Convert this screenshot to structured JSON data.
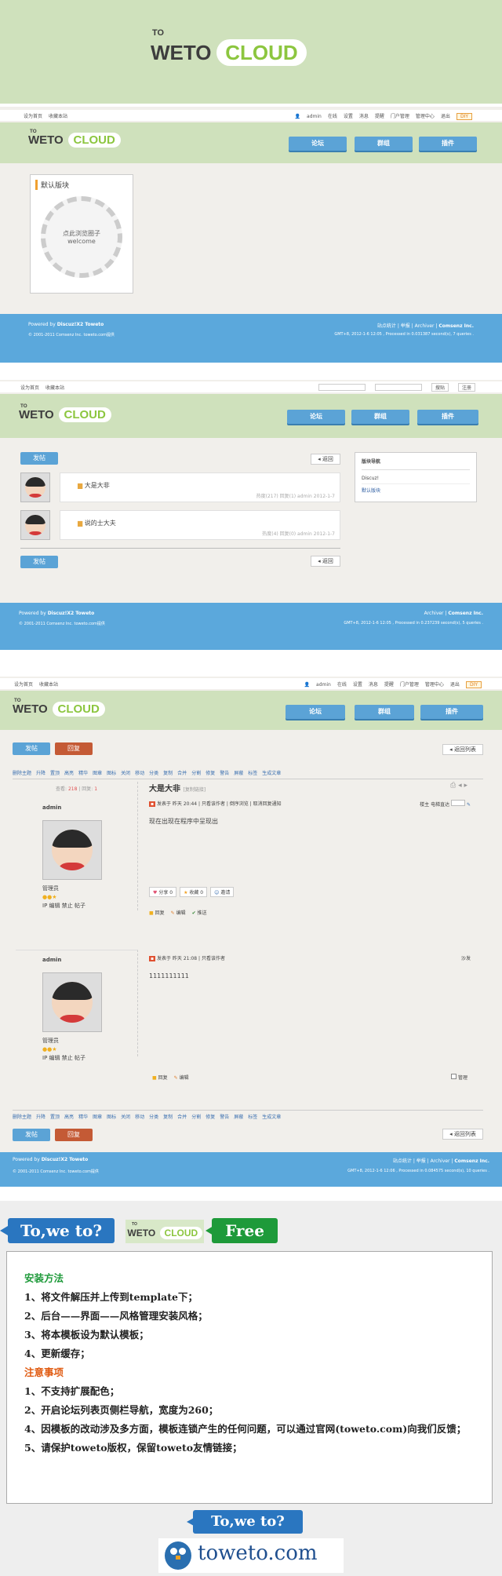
{
  "hero": {
    "to": "TO",
    "weto": "WETO",
    "cloud": "CLOUD"
  },
  "topbar": {
    "left": [
      "设为首页",
      "收藏本站"
    ],
    "user": "admin",
    "links": [
      "在线",
      "设置",
      "消息",
      "提醒",
      "门户管理",
      "管理中心",
      "退出"
    ],
    "diy": "DIY"
  },
  "nav": [
    "论坛",
    "群组",
    "插件"
  ],
  "panel1": {
    "block_title": "默认版块",
    "circle_line1": "点此浏览圈子",
    "circle_line2": "welcome"
  },
  "footer1": {
    "powered": "Powered by",
    "brand": "Discuz!X2 Toweto",
    "copy": "© 2001-2011 Comsenz Inc. toweto.com提供",
    "links": [
      "站点统计",
      "举报",
      "Archiver",
      "Comsenz Inc."
    ],
    "gmt": "GMT+8, 2012-1-6 12:05 , Processed in 0.031387 second(s), 7 queries ."
  },
  "panel2": {
    "search_btn": "搜贴",
    "search_btn2": "注册",
    "post_btn": "发帖",
    "back_btn": "返回",
    "threads": [
      {
        "title": "大是大非",
        "meta": "热度(217)  回复(1)  admin  2012-1-7"
      },
      {
        "title": "说的士大夫",
        "meta": "热度(4)  回复(0)  admin  2012-1-7"
      }
    ],
    "side_title": "版块导航",
    "side_items": [
      "Discuz!",
      "默认版块"
    ]
  },
  "footer2": {
    "powered": "Powered by",
    "brand": "Discuz!X2 Toweto",
    "copy": "© 2001-2011 Comsenz Inc. toweto.com提供",
    "links": [
      "Archiver",
      "Comsenz Inc."
    ],
    "gmt": "GMT+8, 2012-1-6 12:05 , Processed in 0.237239 second(s), 5 queries ."
  },
  "panel3": {
    "post_btn": "发帖",
    "reply_btn": "回复",
    "back_list": "返回列表",
    "mod_links": [
      "删除主题",
      "升降",
      "置顶",
      "高亮",
      "精华",
      "图章",
      "图标",
      "关闭",
      "移动",
      "分类",
      "复制",
      "合并",
      "分割",
      "修复",
      "警告",
      "屏蔽",
      "标签",
      "生成文章"
    ],
    "views_label": "查看",
    "views": "218",
    "replies_label": "回复",
    "replies": "1",
    "thread_title": "大是大非",
    "copy_link": "[复制链接]",
    "post1": {
      "author": "admin",
      "role": "管理员",
      "actions": "IP  编辑  禁止  帖子",
      "meta": "发表于  昨天 20:44  |  只看该作者  |  倒序浏览  |  取消回复通知",
      "floor": "楼主",
      "jump": "电梯直达",
      "content": "现在出现在程序中呈现出",
      "share": "分享",
      "fav": "收藏",
      "invite": "邀请",
      "ops": [
        "回复",
        "编辑",
        "推送"
      ]
    },
    "post2": {
      "author": "admin",
      "role": "管理员",
      "actions": "IP  编辑  禁止  帖子",
      "meta": "发表于  昨天 21:08  |  只看该作者",
      "floor": "沙发",
      "content": "1111111111",
      "ops": [
        "回复",
        "编辑"
      ],
      "manage": "管理"
    }
  },
  "footer3": {
    "powered": "Powered by",
    "brand": "Discuz!X2 Toweto",
    "copy": "© 2001-2011 Comsenz Inc. toweto.com提供",
    "links": [
      "站点统计",
      "举报",
      "Archiver",
      "Comsenz Inc."
    ],
    "gmt": "GMT+8, 2012-1-6 12:06 , Processed in 0.084575 second(s), 10 queries ."
  },
  "promo": {
    "bubble1": "To,we to?",
    "bubble2": "Free",
    "install_title": "安装方法",
    "install": [
      "1、将文件解压并上传到template下；",
      "2、后台——界面——风格管理安装风格；",
      "3、将本模板设为默认模板；",
      "4、更新缓存；"
    ],
    "note_title": "注意事项",
    "notes": [
      "1、不支持扩展配色；",
      "2、开启论坛列表页侧栏导航，宽度为260；",
      "4、因模板的改动涉及多方面，模板连锁产生的任何问题，可以通过官网(toweto.com)向我们反馈；",
      "5、请保护toweto版权，保留toweto友情链接；"
    ],
    "bottom_bubble": "To,we to?",
    "site": "toweto.com"
  },
  "colors": {
    "green": "#cfe1bc",
    "blue": "#5ba8dc",
    "red": "#c45a35"
  }
}
